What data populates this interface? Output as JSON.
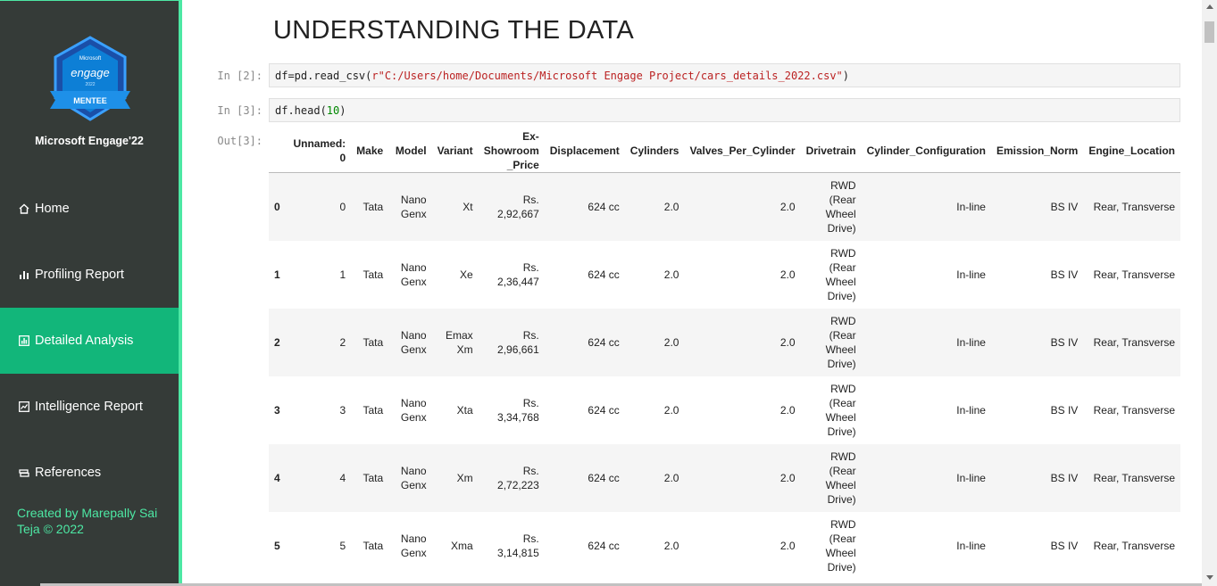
{
  "sidebar": {
    "brand": "Microsoft Engage'22",
    "badge_text": {
      "top": "Microsoft",
      "program": "engage",
      "year": "2022",
      "ribbon": "MENTEE"
    },
    "items": [
      {
        "label": "Home",
        "icon": "home-icon",
        "active": false
      },
      {
        "label": "Profiling Report",
        "icon": "bar-chart-icon",
        "active": false
      },
      {
        "label": "Detailed Analysis",
        "icon": "chart-box-icon",
        "active": true
      },
      {
        "label": "Intelligence Report",
        "icon": "report-icon",
        "active": false
      },
      {
        "label": "References",
        "icon": "books-icon",
        "active": false
      }
    ],
    "credit": "Created by Marepally Sai Teja © 2022",
    "accent": "#4de8a4",
    "active_bg": "#12b67a"
  },
  "notebook": {
    "heading": "UNDERSTANDING THE DATA",
    "cells": [
      {
        "prompt": "In [2]:",
        "code_prefix": "df=pd.read_csv(",
        "code_string": "r\"C:/Users/home/Documents/Microsoft Engage Project/cars_details_2022.csv\"",
        "code_suffix": ")"
      },
      {
        "prompt": "In [3]:",
        "code_prefix": "df.head(",
        "code_number": "10",
        "code_suffix": ")"
      }
    ],
    "output_prompt": "Out[3]:"
  },
  "table": {
    "columns": [
      "",
      "Unnamed: 0",
      "Make",
      "Model",
      "Variant",
      "Ex-Showroom_Price",
      "Displacement",
      "Cylinders",
      "Valves_Per_Cylinder",
      "Drivetrain",
      "Cylinder_Configuration",
      "Emission_Norm",
      "Engine_Location"
    ],
    "rows": [
      [
        "0",
        "0",
        "Tata",
        "Nano Genx",
        "Xt",
        "Rs. 2,92,667",
        "624 cc",
        "2.0",
        "2.0",
        "RWD (Rear Wheel Drive)",
        "In-line",
        "BS IV",
        "Rear, Transverse"
      ],
      [
        "1",
        "1",
        "Tata",
        "Nano Genx",
        "Xe",
        "Rs. 2,36,447",
        "624 cc",
        "2.0",
        "2.0",
        "RWD (Rear Wheel Drive)",
        "In-line",
        "BS IV",
        "Rear, Transverse"
      ],
      [
        "2",
        "2",
        "Tata",
        "Nano Genx",
        "Emax Xm",
        "Rs. 2,96,661",
        "624 cc",
        "2.0",
        "2.0",
        "RWD (Rear Wheel Drive)",
        "In-line",
        "BS IV",
        "Rear, Transverse"
      ],
      [
        "3",
        "3",
        "Tata",
        "Nano Genx",
        "Xta",
        "Rs. 3,34,768",
        "624 cc",
        "2.0",
        "2.0",
        "RWD (Rear Wheel Drive)",
        "In-line",
        "BS IV",
        "Rear, Transverse"
      ],
      [
        "4",
        "4",
        "Tata",
        "Nano Genx",
        "Xm",
        "Rs. 2,72,223",
        "624 cc",
        "2.0",
        "2.0",
        "RWD (Rear Wheel Drive)",
        "In-line",
        "BS IV",
        "Rear, Transverse"
      ],
      [
        "5",
        "5",
        "Tata",
        "Nano Genx",
        "Xma",
        "Rs. 3,14,815",
        "624 cc",
        "2.0",
        "2.0",
        "RWD (Rear Wheel Drive)",
        "In-line",
        "BS IV",
        "Rear, Transverse"
      ]
    ]
  }
}
